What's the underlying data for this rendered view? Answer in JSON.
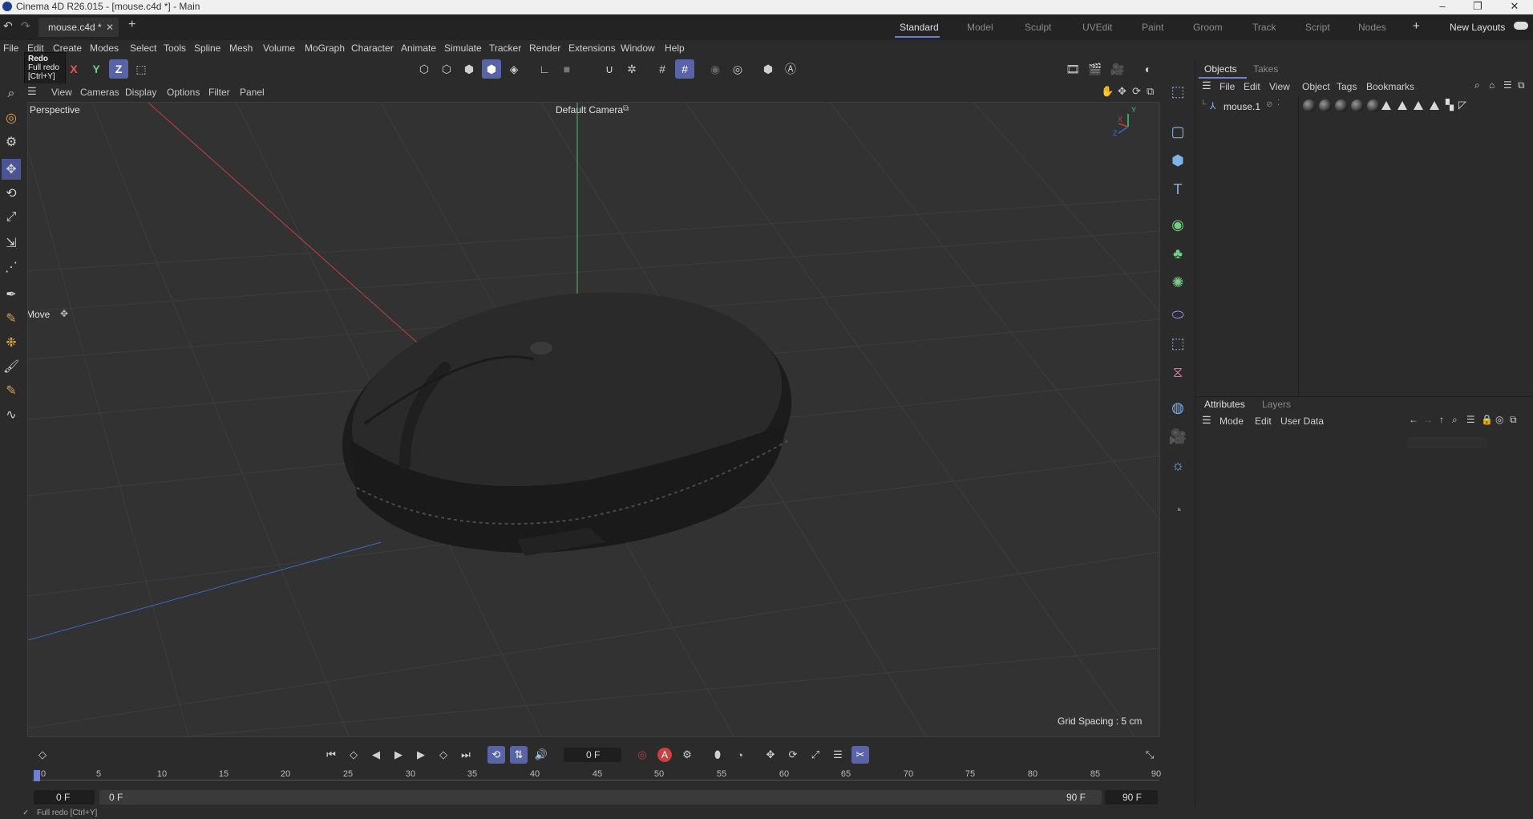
{
  "window": {
    "title": "Cinema 4D R26.015 - [mouse.c4d *] - Main",
    "minimize": "–",
    "maximize": "❐",
    "close": "✕"
  },
  "tabs": {
    "file_tab": "mouse.c4d *",
    "file_tab_close": "✕",
    "add_tab": "+",
    "layouts": [
      "Standard",
      "Model",
      "Sculpt",
      "UVEdit",
      "Paint",
      "Groom",
      "Track",
      "Script",
      "Nodes"
    ],
    "active_layout": "Standard",
    "add_layout": "+",
    "new_layouts": "New Layouts"
  },
  "menubar": [
    "File",
    "Edit",
    "Create",
    "Modes",
    "Select",
    "Tools",
    "Spline",
    "Mesh",
    "Volume",
    "MoGraph",
    "Character",
    "Animate",
    "Simulate",
    "Tracker",
    "Render",
    "Extensions",
    "Window",
    "Help"
  ],
  "tooltip": {
    "title": "Redo",
    "line1": "Full redo",
    "line2": "[Ctrl+Y]"
  },
  "axis_buttons": {
    "x": "X",
    "y": "Y",
    "z": "Z"
  },
  "viewport_menu": [
    "View",
    "Cameras",
    "Display",
    "Options",
    "Filter",
    "Panel"
  ],
  "viewport": {
    "label": "Perspective",
    "camera": "Default Camera",
    "grid_spacing": "Grid Spacing : 5 cm",
    "tool_label": "Move",
    "axis_x": "X",
    "axis_y": "Y",
    "axis_z": "Z"
  },
  "objects_panel": {
    "tabs": [
      "Objects",
      "Takes"
    ],
    "menu": [
      "File",
      "Edit",
      "View",
      "Object",
      "Tags",
      "Bookmarks"
    ],
    "object_name": "mouse.1"
  },
  "attributes_panel": {
    "tabs": [
      "Attributes",
      "Layers"
    ],
    "menu": [
      "Mode",
      "Edit",
      "User Data"
    ]
  },
  "timeline": {
    "current_frame": "0 F",
    "ruler": [
      "0",
      "5",
      "10",
      "15",
      "20",
      "25",
      "30",
      "35",
      "40",
      "45",
      "50",
      "55",
      "60",
      "65",
      "70",
      "75",
      "80",
      "85",
      "90"
    ],
    "start_field": "0 F",
    "range_start": "0 F",
    "range_end": "90 F",
    "end_field": "90 F"
  },
  "status": "Full redo [Ctrl+Y]",
  "colors": {
    "accent": "#5964a8",
    "bg": "#2b2b2b",
    "viewport_bg": "#323232",
    "x_axis": "#c0413c",
    "y_axis": "#4fc46a",
    "z_axis": "#3a6bc4"
  }
}
